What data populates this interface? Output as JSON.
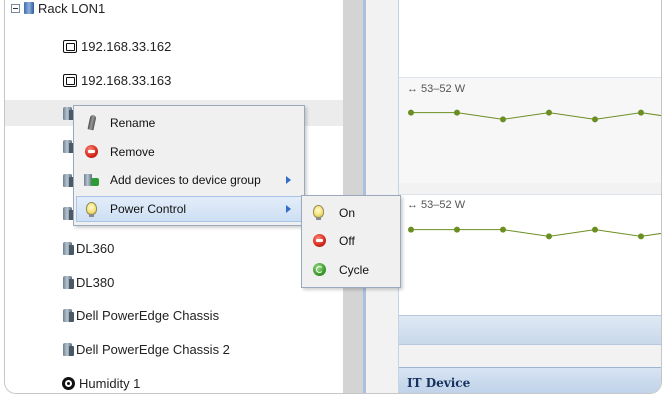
{
  "tree": {
    "items": [
      {
        "label": "Rack LON1",
        "icon": "rack-icon"
      },
      {
        "label": "192.168.33.162",
        "icon": "outlet-icon"
      },
      {
        "label": "192.168.33.163",
        "icon": "outlet-icon"
      },
      {
        "label": "",
        "icon": "server-icon"
      },
      {
        "label": "",
        "icon": "server-icon"
      },
      {
        "label": "",
        "icon": "server-icon"
      },
      {
        "label": "",
        "icon": "server-icon"
      },
      {
        "label": "DL360",
        "icon": "server-icon"
      },
      {
        "label": "DL380",
        "icon": "server-icon"
      },
      {
        "label": "Dell PowerEdge Chassis",
        "icon": "server-icon"
      },
      {
        "label": "Dell PowerEdge Chassis 2",
        "icon": "server-icon"
      },
      {
        "label": "Humidity 1",
        "icon": "humidity-sensor-icon"
      }
    ]
  },
  "context_menu": {
    "items": [
      {
        "label": "Rename",
        "icon": "pencil-icon"
      },
      {
        "label": "Remove",
        "icon": "remove-icon"
      },
      {
        "label": "Add devices to device group",
        "icon": "device-group-icon",
        "has_submenu": true
      },
      {
        "label": "Power Control",
        "icon": "bulb-icon",
        "has_submenu": true
      }
    ]
  },
  "power_submenu": {
    "items": [
      {
        "label": "On",
        "icon": "bulb-icon"
      },
      {
        "label": "Off",
        "icon": "remove-icon"
      },
      {
        "label": "Cycle",
        "icon": "cycle-icon"
      }
    ]
  },
  "charts": [
    {
      "label": "↔ 53–52 W",
      "values": [
        53,
        53,
        52,
        53,
        52,
        53,
        52,
        53,
        53
      ]
    },
    {
      "label": "↔ 53–52 W",
      "values": [
        53,
        53,
        53,
        52,
        53,
        52,
        53,
        52,
        53
      ]
    }
  ],
  "it_device": {
    "title": "IT Device"
  },
  "colors": {
    "accent": "#2f6fc9",
    "series": "#6b8e23",
    "header_text": "#15315c"
  }
}
